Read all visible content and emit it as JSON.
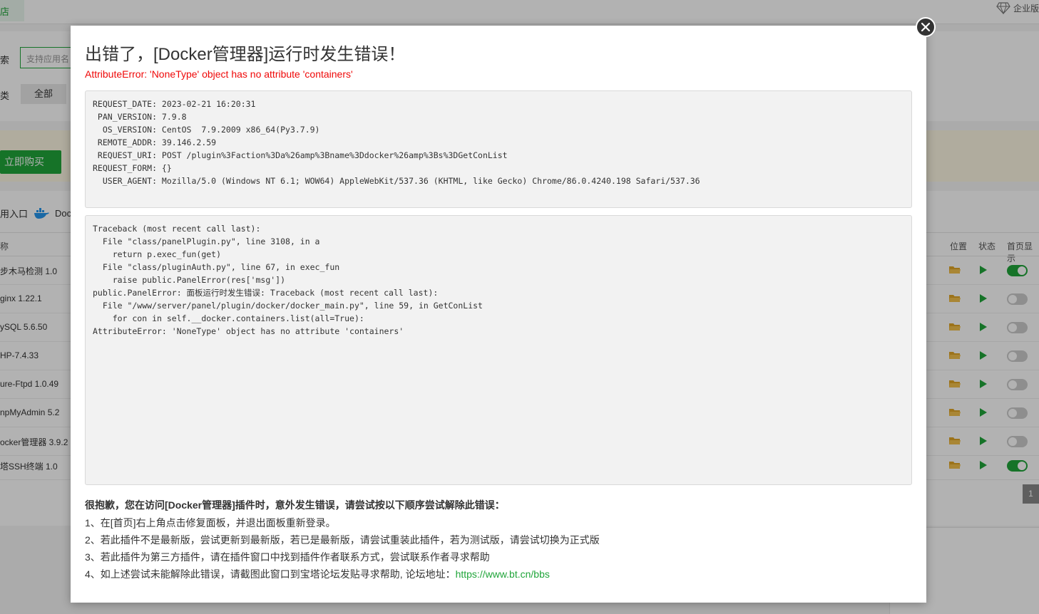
{
  "background": {
    "top_tab": "店",
    "enterprise_label": "企业版",
    "filter": {
      "search_label": "索",
      "search_placeholder": "支持应用名",
      "category_label": "类",
      "all_button": "全部"
    },
    "buy_button": "立即购买",
    "quick_entries": [
      "用入口",
      "Doc"
    ],
    "table": {
      "headers": {
        "name": "称",
        "position": "位置",
        "state": "状态",
        "home": "首页显示"
      },
      "rows": [
        {
          "name": "步木马检测 1.0",
          "home_on": true
        },
        {
          "name": "ginx 1.22.1",
          "home_on": false
        },
        {
          "name": "ySQL 5.6.50",
          "home_on": false
        },
        {
          "name": "HP-7.4.33",
          "home_on": false
        },
        {
          "name": "ure-Ftpd 1.0.49",
          "home_on": false
        },
        {
          "name": "npMyAdmin 5.2",
          "home_on": false
        },
        {
          "name": "ocker管理器 3.9.2",
          "home_on": false
        },
        {
          "name": "塔SSH终端 1.0",
          "home_on": true
        }
      ]
    },
    "pager": "1"
  },
  "modal": {
    "title": "出错了，[Docker管理器]运行时发生错误！",
    "error_message": "AttributeError: 'NoneType' object has no attribute 'containers'",
    "request_info": [
      "REQUEST_DATE: 2023-02-21 16:20:31",
      " PAN_VERSION: 7.9.8",
      "  OS_VERSION: CentOS  7.9.2009 x86_64(Py3.7.9)",
      " REMOTE_ADDR: 39.146.2.59",
      " REQUEST_URI: POST /plugin%3Faction%3Da%26amp%3Bname%3Ddocker%26amp%3Bs%3DGetConList",
      "REQUEST_FORM: {}",
      "  USER_AGENT: Mozilla/5.0 (Windows NT 6.1; WOW64) AppleWebKit/537.36 (KHTML, like Gecko) Chrome/86.0.4240.198 Safari/537.36"
    ],
    "traceback": [
      "Traceback (most recent call last):",
      "  File \"class/panelPlugin.py\", line 3108, in a",
      "    return p.exec_fun(get)",
      "  File \"class/pluginAuth.py\", line 67, in exec_fun",
      "    raise public.PanelError(res['msg'])",
      "public.PanelError: 面板运行时发生错误: Traceback (most recent call last):",
      "  File \"/www/server/panel/plugin/docker/docker_main.py\", line 59, in GetConList",
      "    for con in self.__docker.containers.list(all=True):",
      "AttributeError: 'NoneType' object has no attribute 'containers'"
    ],
    "help_title": "很抱歉，您在访问[Docker管理器]插件时，意外发生错误，请尝试按以下顺序尝试解除此错误：",
    "help_steps": [
      "1、在[首页]右上角点击修复面板，并退出面板重新登录。",
      "2、若此插件不是最新版，尝试更新到最新版，若已是最新版，请尝试重装此插件，若为测试版，请尝试切换为正式版",
      "3、若此插件为第三方插件，请在插件窗口中找到插件作者联系方式，尝试联系作者寻求帮助",
      "4、如上述尝试未能解除此错误，请截图此窗口到宝塔论坛发贴寻求帮助, 论坛地址："
    ],
    "forum_link": "https://www.bt.cn/bbs"
  },
  "colors": {
    "accent": "#20a53a",
    "error": "#ef0808"
  }
}
